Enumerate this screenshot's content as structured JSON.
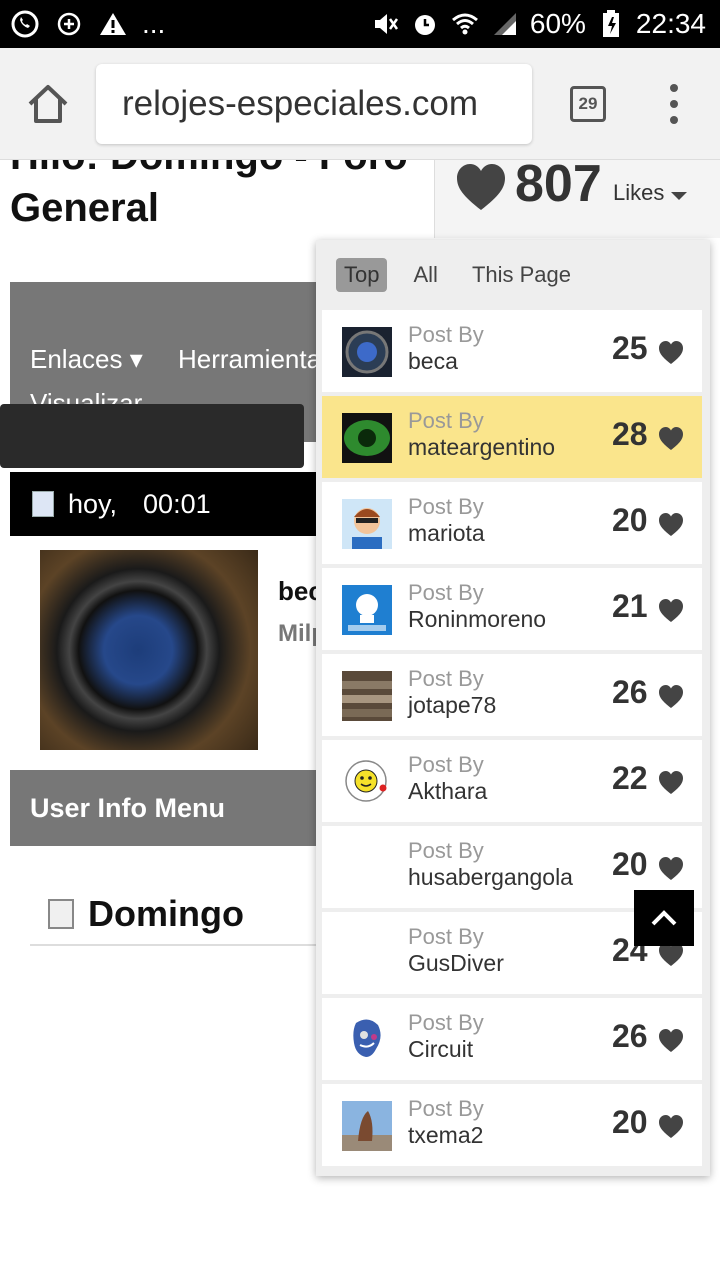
{
  "status_bar": {
    "battery": "60%",
    "time": "22:34",
    "ellipsis": "...",
    "icons": [
      "whatsapp-icon",
      "vpn-icon",
      "warning-icon",
      "mute-icon",
      "alarm-icon",
      "wifi-icon",
      "signal-icon",
      "battery-icon"
    ]
  },
  "browser": {
    "url": "relojes-especiales.com",
    "tab_count": "29"
  },
  "page": {
    "thread_title": "Hilo: Domingo - Foro General",
    "likes": {
      "count": "807",
      "label": "Likes"
    },
    "nav": {
      "enlaces": "Enlaces",
      "herramientas": "Herramientas",
      "visualizar": "Visualizar"
    },
    "date": {
      "day": "hoy,",
      "time": "00:01"
    },
    "post": {
      "author": "beca",
      "rank": "Milpo"
    },
    "user_info_menu": "User Info Menu",
    "post_title": "Domingo"
  },
  "likes_panel": {
    "tabs": [
      "Top",
      "All",
      "This Page"
    ],
    "active_tab": "Top",
    "post_by_label": "Post By",
    "rows": [
      {
        "author": "beca",
        "count": "25",
        "highlight": false
      },
      {
        "author": "mateargentino",
        "count": "28",
        "highlight": true
      },
      {
        "author": "mariota",
        "count": "20",
        "highlight": false
      },
      {
        "author": "Roninmoreno",
        "count": "21",
        "highlight": false
      },
      {
        "author": "jotape78",
        "count": "26",
        "highlight": false
      },
      {
        "author": "Akthara",
        "count": "22",
        "highlight": false
      },
      {
        "author": "husabergangola",
        "count": "20",
        "highlight": false
      },
      {
        "author": "GusDiver",
        "count": "24",
        "highlight": false
      },
      {
        "author": "Circuit",
        "count": "26",
        "highlight": false
      },
      {
        "author": "txema2",
        "count": "20",
        "highlight": false
      }
    ]
  },
  "colors": {
    "highlight_row": "#fae58c",
    "nav_gray": "#777777",
    "heart": "#444444"
  }
}
